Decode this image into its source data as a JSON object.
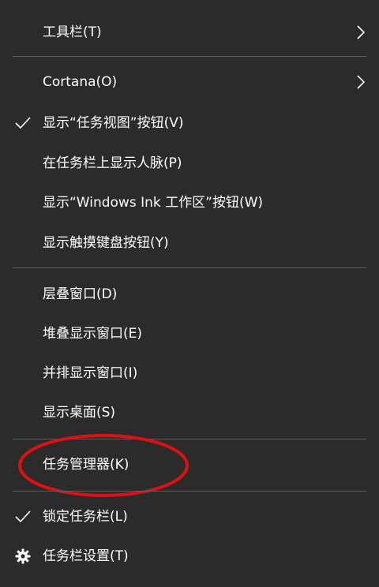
{
  "menu": {
    "items": [
      {
        "label": "工具栏(T)",
        "submenu": true,
        "checked": false
      },
      {
        "label": "Cortana(O)",
        "submenu": true,
        "checked": false
      },
      {
        "label": "显示“任务视图”按钮(V)",
        "submenu": false,
        "checked": true
      },
      {
        "label": "在任务栏上显示人脉(P)",
        "submenu": false,
        "checked": false
      },
      {
        "label": "显示“Windows Ink 工作区”按钮(W)",
        "submenu": false,
        "checked": false
      },
      {
        "label": "显示触摸键盘按钮(Y)",
        "submenu": false,
        "checked": false
      },
      {
        "label": "层叠窗口(D)",
        "submenu": false,
        "checked": false
      },
      {
        "label": "堆叠显示窗口(E)",
        "submenu": false,
        "checked": false
      },
      {
        "label": "并排显示窗口(I)",
        "submenu": false,
        "checked": false
      },
      {
        "label": "显示桌面(S)",
        "submenu": false,
        "checked": false
      },
      {
        "label": "任务管理器(K)",
        "submenu": false,
        "checked": false,
        "annotated": true
      },
      {
        "label": "锁定任务栏(L)",
        "submenu": false,
        "checked": true
      },
      {
        "label": "任务栏设置(T)",
        "submenu": false,
        "checked": false,
        "icon": "gear-icon"
      }
    ]
  },
  "colors": {
    "background": "#2b2b2b",
    "text": "#ffffff",
    "separator": "#5c5c5c",
    "annotation": "#e01010"
  }
}
